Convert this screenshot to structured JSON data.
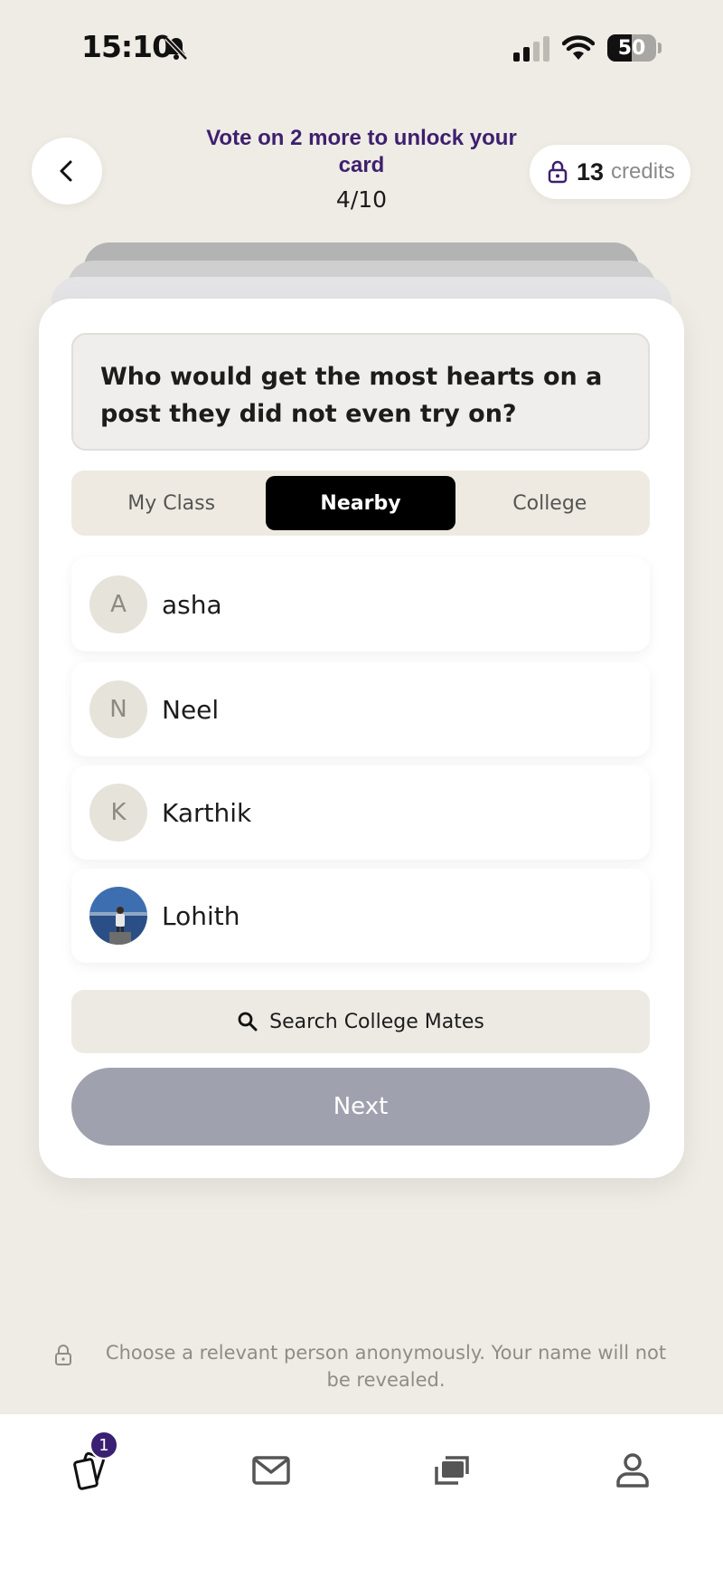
{
  "status_bar": {
    "time": "15:10",
    "battery": "50",
    "battery_level": 0.5
  },
  "header": {
    "title": "Vote on 2 more to unlock your card",
    "progress": "4/10",
    "credits_count": "13",
    "credits_label": "credits"
  },
  "question": "Who would get the most hearts on a post they did not even try on?",
  "tabs": [
    {
      "label": "My Class",
      "active": false
    },
    {
      "label": "Nearby",
      "active": true
    },
    {
      "label": "College",
      "active": false
    }
  ],
  "options": [
    {
      "initial": "A",
      "name": "asha",
      "has_photo": false
    },
    {
      "initial": "N",
      "name": "Neel",
      "has_photo": false
    },
    {
      "initial": "K",
      "name": "Karthik",
      "has_photo": false
    },
    {
      "initial": "",
      "name": "Lohith",
      "has_photo": true
    }
  ],
  "search_label": "Search College Mates",
  "next_label": "Next",
  "footer_note": "Choose a relevant person anonymously. Your name will not be revealed.",
  "nav": {
    "badge_count": "1"
  },
  "colors": {
    "accent": "#3e1f6e",
    "background": "#efece5",
    "next_disabled": "#9fa2ae"
  }
}
